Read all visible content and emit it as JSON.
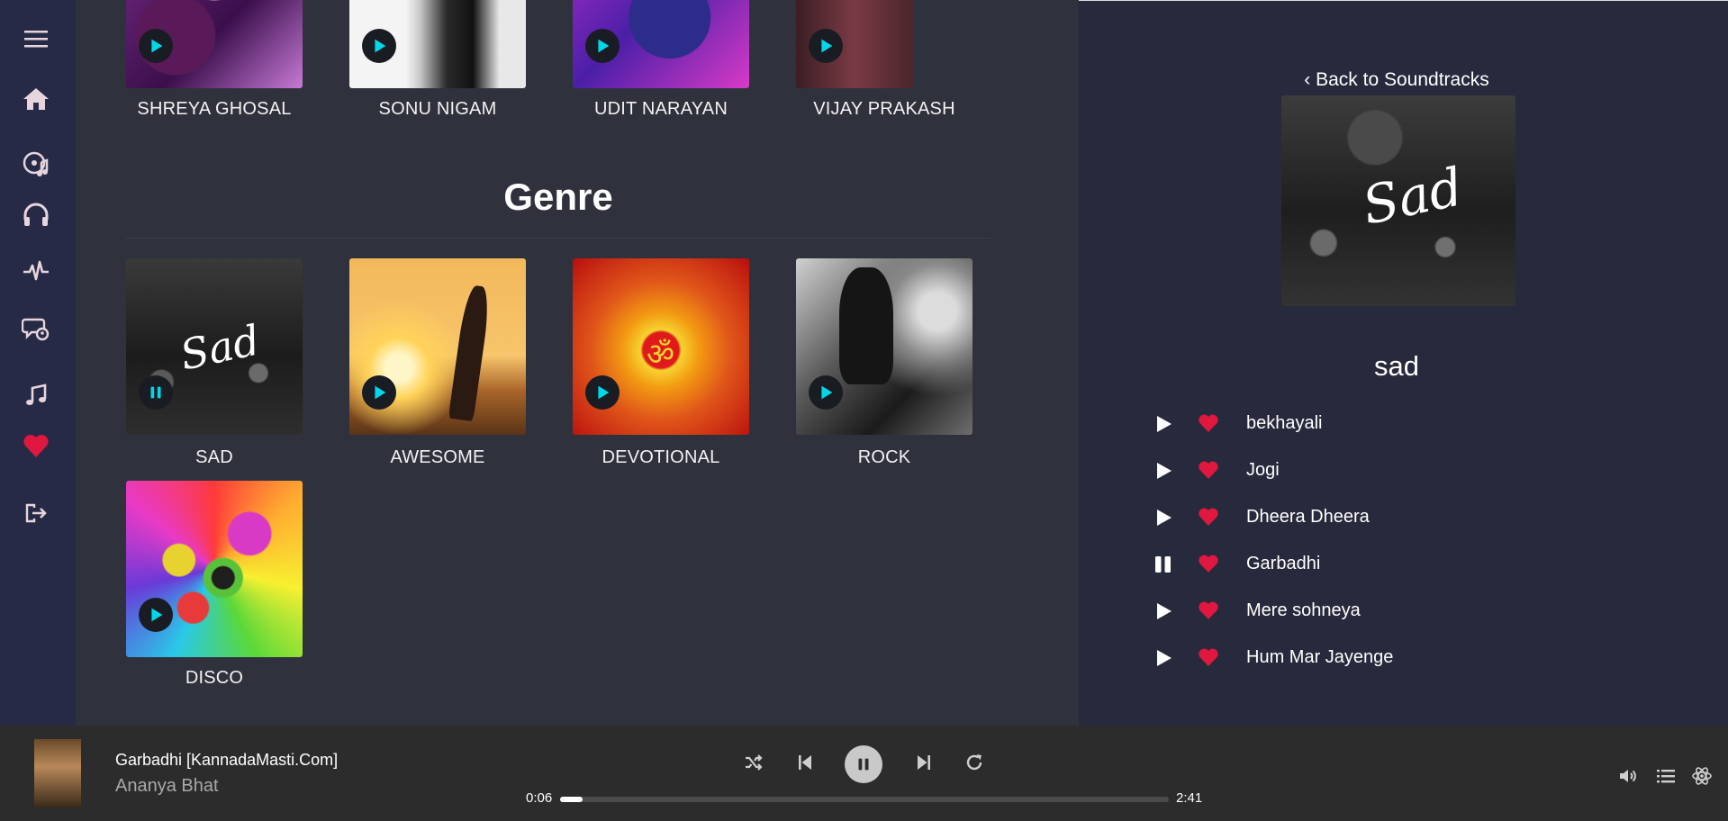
{
  "artists": [
    {
      "label": "SHREYA GHOSAL",
      "icon": "play-icon"
    },
    {
      "label": "SONU NIGAM",
      "icon": "play-icon"
    },
    {
      "label": "UDIT NARAYAN",
      "icon": "play-icon"
    },
    {
      "label": "VIJAY PRAKASH",
      "icon": "play-icon"
    }
  ],
  "genre_heading": "Genre",
  "genres": [
    {
      "label": "SAD",
      "icon": "pause-icon",
      "cover_text": "Sad"
    },
    {
      "label": "AWESOME",
      "icon": "play-icon"
    },
    {
      "label": "DEVOTIONAL",
      "icon": "play-icon"
    },
    {
      "label": "ROCK",
      "icon": "play-icon"
    },
    {
      "label": "DISCO",
      "icon": "play-icon"
    }
  ],
  "sidebar": {
    "icons": [
      "menu-icon",
      "home-icon",
      "music-disc-icon",
      "headphones-icon",
      "pulse-icon",
      "chat-icon",
      "music-note-icon",
      "heart-icon",
      "logout-icon"
    ]
  },
  "panel": {
    "back_link": "‹ Back to Soundtracks",
    "cover_text": "Sad",
    "playlist_name": "sad",
    "tracks": [
      {
        "name": "bekhayali",
        "state": "play"
      },
      {
        "name": "Jogi",
        "state": "play"
      },
      {
        "name": "Dheera Dheera",
        "state": "play"
      },
      {
        "name": "Garbadhi",
        "state": "pause"
      },
      {
        "name": "Mere sohneya",
        "state": "play"
      },
      {
        "name": "Hum Mar Jayenge",
        "state": "play"
      }
    ]
  },
  "player": {
    "title": "Garbadhi [KannadaMasti.Com]",
    "artist": "Ananya Bhat",
    "current_time": "0:06",
    "total_time": "2:41",
    "progress": 0.037
  },
  "colors": {
    "accent": "#00d8e8",
    "heart": "#e0173f"
  }
}
